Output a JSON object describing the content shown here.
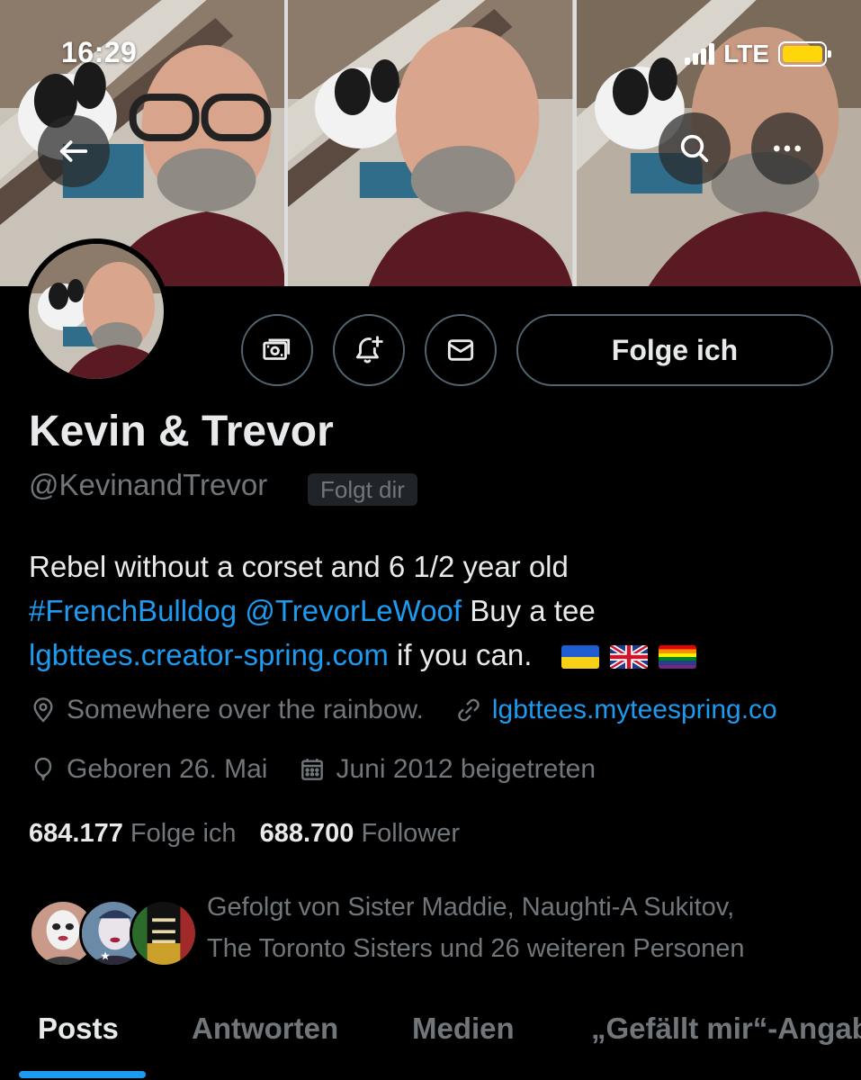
{
  "status_bar": {
    "time": "16:29",
    "network": "LTE"
  },
  "header": {
    "back_icon": "arrow-left-icon",
    "search_icon": "search-icon",
    "more_icon": "more-horizontal-icon"
  },
  "profile": {
    "name": "Kevin & Trevor",
    "handle": "@KevinandTrevor",
    "follows_you_badge": "Folgt dir",
    "follow_button_label": "Folge ich",
    "action_icons": [
      "subscribe-money-icon",
      "notification-bell-plus-icon",
      "message-envelope-icon"
    ]
  },
  "bio": {
    "line1": "Rebel without a corset and 6 1/2 year old",
    "hashtag": "#FrenchBulldog",
    "mention": "@TrevorLeWoof",
    "line2_suffix": " Buy a tee",
    "link": "lgbttees.creator-spring.com",
    "line3_suffix": " if you can.",
    "flags": [
      "ukraine-flag",
      "uk-flag",
      "rainbow-flag"
    ]
  },
  "meta": {
    "location": "Somewhere over the rainbow.",
    "website": "lgbttees.myteespring.co",
    "birthday": "Geboren 26. Mai",
    "joined": "Juni 2012 beigetreten"
  },
  "stats": {
    "following_count": "684.177",
    "following_label": "Folge ich",
    "followers_count": "688.700",
    "followers_label": "Follower"
  },
  "followed_by": {
    "line1": "Gefolgt von Sister Maddie, Naughti-A Sukitov,",
    "line2": "The Toronto Sisters und 26 weiteren Personen"
  },
  "tabs": [
    {
      "label": "Posts",
      "active": true
    },
    {
      "label": "Antworten",
      "active": false
    },
    {
      "label": "Medien",
      "active": false
    },
    {
      "label": "„Gefällt mir“-Angaben",
      "active": false
    }
  ],
  "colors": {
    "accent": "#1d9bf0",
    "muted": "#71767b",
    "text": "#e7e9ea",
    "background": "#000000",
    "border": "#536471"
  }
}
